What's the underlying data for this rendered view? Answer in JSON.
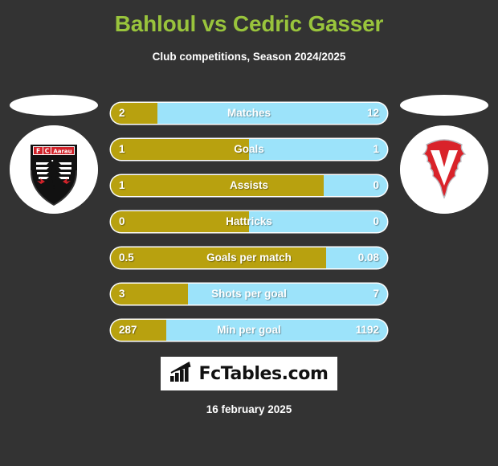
{
  "header": {
    "title": "Bahloul vs Cedric Gasser",
    "subtitle": "Club competitions, Season 2024/2025",
    "title_color": "#99c43c"
  },
  "teams": {
    "home": {
      "name": "FC Aarau",
      "crest": "fc-aarau-crest",
      "badge_text": "FC Aarau"
    },
    "away": {
      "name": "FC Vaduz",
      "crest": "fc-vaduz-crest",
      "badge_text": "V"
    }
  },
  "colors": {
    "background": "#333333",
    "home_bar": "#b8a10f",
    "away_bar": "#9ce3fa",
    "accent": "#99c43c",
    "text": "#ffffff"
  },
  "chart_data": {
    "type": "bar",
    "title": "Bahloul vs Cedric Gasser",
    "subtitle": "Club competitions, Season 2024/2025",
    "categories": [
      "Matches",
      "Goals",
      "Assists",
      "Hattricks",
      "Goals per match",
      "Shots per goal",
      "Min per goal"
    ],
    "series": [
      {
        "name": "Bahloul",
        "values": [
          2,
          1,
          1,
          0,
          0.5,
          3,
          287
        ]
      },
      {
        "name": "Cedric Gasser",
        "values": [
          12,
          1,
          0,
          0,
          0.08,
          7,
          1192
        ]
      }
    ],
    "legend": "none",
    "grid": false
  },
  "stats": [
    {
      "label": "Matches",
      "home": "2",
      "away": "12",
      "home_pct": 17
    },
    {
      "label": "Goals",
      "home": "1",
      "away": "1",
      "home_pct": 50
    },
    {
      "label": "Assists",
      "home": "1",
      "away": "0",
      "home_pct": 77
    },
    {
      "label": "Hattricks",
      "home": "0",
      "away": "0",
      "home_pct": 50
    },
    {
      "label": "Goals per match",
      "home": "0.5",
      "away": "0.08",
      "home_pct": 78
    },
    {
      "label": "Shots per goal",
      "home": "3",
      "away": "7",
      "home_pct": 28
    },
    {
      "label": "Min per goal",
      "home": "287",
      "away": "1192",
      "home_pct": 20
    }
  ],
  "footer": {
    "logo_text": "FcTables.com",
    "logo_icon": "bar-chart-icon",
    "date": "16 february 2025"
  }
}
